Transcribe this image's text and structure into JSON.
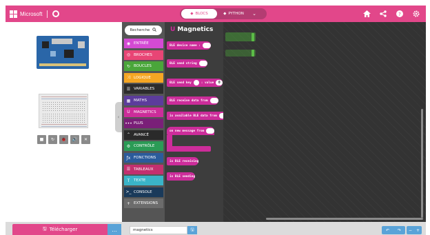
{
  "header": {
    "brand": "Microsoft",
    "brand_icon": "microsoft-logo",
    "microbit_icon": "microbit-icon",
    "mode_blocks": "BLOCS",
    "mode_python": "PYTHON",
    "mode_caret": "⌄",
    "icons": [
      "home-icon",
      "share-icon",
      "help-icon",
      "settings-icon"
    ],
    "accent": "#e2478a"
  },
  "simulator": {
    "controls": [
      "■",
      "↻",
      "🐞",
      "🔊",
      "✕"
    ]
  },
  "toolbox": {
    "search_label": "Recherche",
    "search_icon": "🔍",
    "categories": [
      {
        "label": "ENTRÉE",
        "icon": "◉",
        "color": "#d44ad4"
      },
      {
        "label": "BROCHES",
        "icon": "◎",
        "color": "#e84575"
      },
      {
        "label": "BOUCLES",
        "icon": "↻",
        "color": "#4aa63a"
      },
      {
        "label": "LOGIQUE",
        "icon": "⤨",
        "color": "#f5a623"
      },
      {
        "label": "VARIABLES",
        "icon": "☰",
        "color": "#2c2c2c"
      },
      {
        "label": "MATHS",
        "icon": "▦",
        "color": "#5c3c9c"
      },
      {
        "label": "MAGNETICS",
        "icon": "U",
        "color": "#cc2d9a"
      },
      {
        "label": "PLUS",
        "icon": "•••",
        "color": "#7a1f78"
      },
      {
        "label": "AVANCÉ",
        "icon": "⌃",
        "color": "#2a2a2a"
      },
      {
        "label": "CONTRÔLE",
        "icon": "⚙",
        "color": "#2b9b56"
      },
      {
        "label": "FONCTIONS",
        "icon": "ƒx",
        "color": "#2b5b9b"
      },
      {
        "label": "TABLEAUX",
        "icon": "☰",
        "color": "#c3306f"
      },
      {
        "label": "TEXTE",
        "icon": "T",
        "color": "#3ab4c8"
      },
      {
        "label": "CONSOLE",
        "icon": ">_",
        "color": "#1a3a5a"
      },
      {
        "label": "EXTENSIONS",
        "icon": "+",
        "color": "#6c6c6c"
      }
    ]
  },
  "flyout": {
    "title": "Magnetics",
    "blocks": [
      {
        "text": "BLE device name :"
      },
      {
        "text": "BLE send string"
      },
      {
        "text_a": "BLE send key",
        "text_b": ": value",
        "num": "0"
      },
      {
        "text": "BLE receive data from"
      },
      {
        "text": "is available BLE data from"
      },
      {
        "text": "on new message from"
      },
      {
        "text": "is BLE receiving"
      },
      {
        "text": "is BLE sending"
      }
    ]
  },
  "footer": {
    "download_label": "Télécharger",
    "download_icon": "🖫",
    "more_label": "...",
    "project_name": "magnetics",
    "save_icon": "🖫",
    "undo_icon": "↶",
    "redo_icon": "↷",
    "zoom_out_icon": "−",
    "zoom_in_icon": "+"
  }
}
